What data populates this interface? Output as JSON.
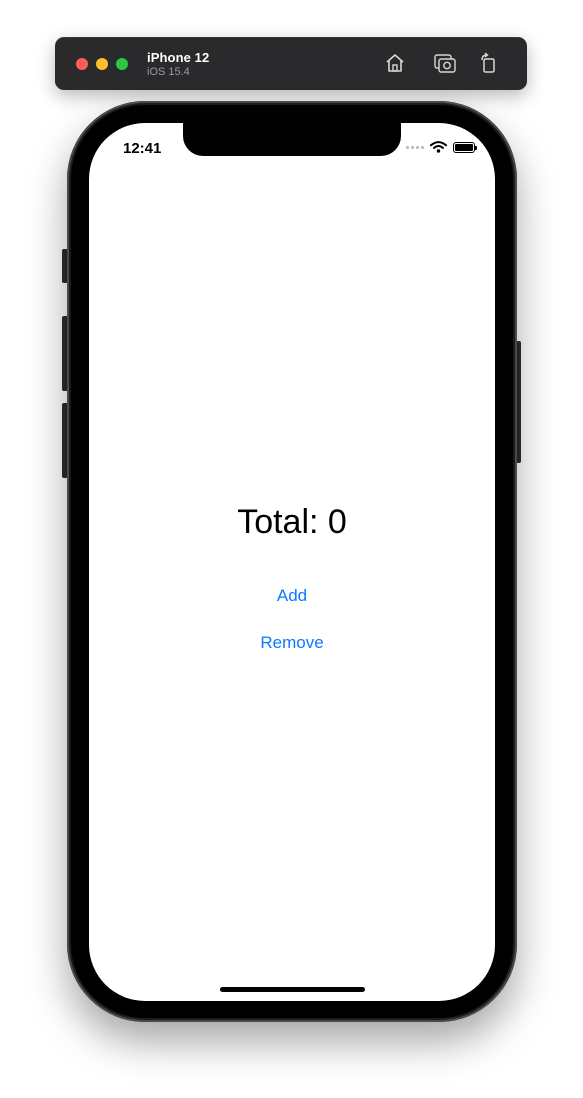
{
  "simulator": {
    "device_name": "iPhone 12",
    "os_version": "iOS 15.4",
    "buttons": [
      {
        "icon": "home-icon"
      },
      {
        "icon": "screenshot-icon"
      },
      {
        "icon": "rotate-icon"
      }
    ]
  },
  "status_bar": {
    "time": "12:41"
  },
  "app": {
    "total_label": "Total: 0",
    "add_label": "Add",
    "remove_label": "Remove",
    "accent_color": "#0a7aff"
  }
}
